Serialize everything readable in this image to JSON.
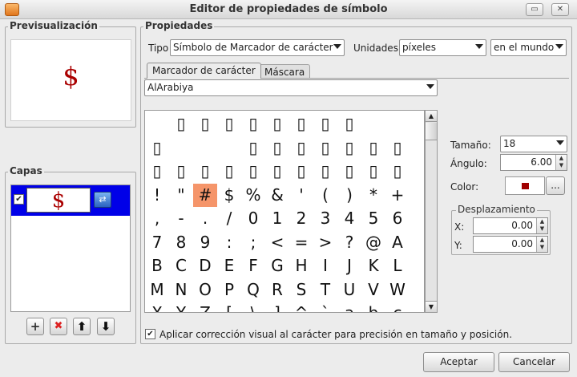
{
  "window": {
    "title": "Editor de propiedades de símbolo",
    "minimize_glyph": "▭",
    "close_glyph": "✕"
  },
  "preview": {
    "title": "Previsualización",
    "symbol": "$",
    "symbol_color": "#a00000"
  },
  "layers": {
    "title": "Capas",
    "row": {
      "checked_glyph": "✔",
      "symbol": "$",
      "icon_glyph": "⇄"
    },
    "buttons": {
      "add": "+",
      "remove": "✖",
      "up": "⬆",
      "down": "⬇"
    }
  },
  "properties": {
    "title": "Propiedades",
    "type_label": "Tipo",
    "type_value": "Símbolo de Marcador de carácter",
    "units_label": "Unidades",
    "units_value": "píxeles",
    "world_value": "en el mundo"
  },
  "tabs": {
    "active": "Marcador de carácter",
    "inactive": "Máscara"
  },
  "font": {
    "value": "AlArabiya"
  },
  "char_grid": {
    "selected_index": 35,
    "rows": [
      [
        "",
        "▯",
        "▯",
        "▯",
        "▯",
        "▯",
        "▯",
        "▯",
        "▯",
        "",
        ""
      ],
      [
        "▯",
        "",
        "",
        "",
        "▯",
        "▯",
        "▯",
        "▯",
        "▯",
        "▯",
        "▯"
      ],
      [
        "▯",
        "▯",
        "▯",
        "▯",
        "▯",
        "▯",
        "▯",
        "▯",
        "▯",
        "▯",
        "▯"
      ],
      [
        "!",
        "\"",
        "#",
        "$",
        "%",
        "&",
        "'",
        "(",
        ")",
        "*",
        "+"
      ],
      [
        ",",
        "-",
        ".",
        "/",
        "0",
        "1",
        "2",
        "3",
        "4",
        "5",
        "6"
      ],
      [
        "7",
        "8",
        "9",
        ":",
        ";",
        "<",
        "=",
        ">",
        "?",
        "@",
        "A"
      ],
      [
        "B",
        "C",
        "D",
        "E",
        "F",
        "G",
        "H",
        "I",
        "J",
        "K",
        "L"
      ],
      [
        "M",
        "N",
        "O",
        "P",
        "Q",
        "R",
        "S",
        "T",
        "U",
        "V",
        "W"
      ],
      [
        "X",
        "Y",
        "Z",
        "[",
        "\\",
        "]",
        "^",
        "`",
        "a",
        "b",
        "c"
      ]
    ]
  },
  "right_panel": {
    "size_label": "Tamaño:",
    "size_value": "18",
    "angle_label": "Ángulo:",
    "angle_value": "6.00",
    "color_label": "Color:",
    "color_value": "#a00000",
    "color_button": "...",
    "offset_title": "Desplazamiento",
    "x_label": "X:",
    "x_value": "0.00",
    "y_label": "Y:",
    "y_value": "0.00"
  },
  "checkbox": {
    "checked": true,
    "label": "Aplicar corrección visual al carácter para precisión en tamaño y posición."
  },
  "buttons": {
    "accept": "Aceptar",
    "cancel": "Cancelar"
  }
}
